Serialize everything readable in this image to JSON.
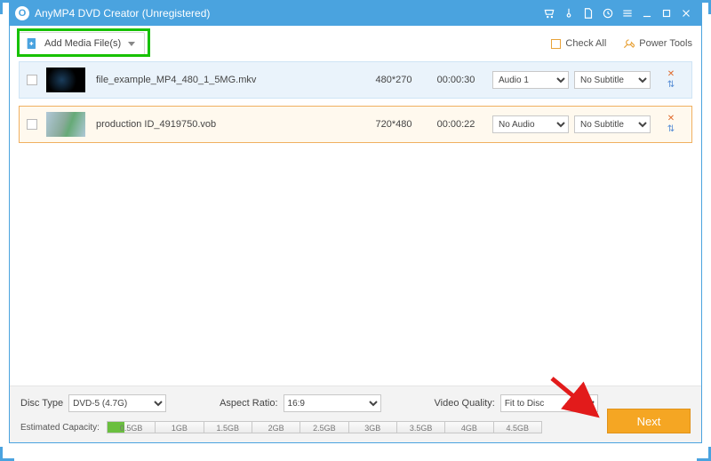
{
  "titlebar": {
    "title": "AnyMP4 DVD Creator (Unregistered)"
  },
  "toolbar": {
    "add_label": "Add Media File(s)",
    "check_all_label": "Check All",
    "power_tools_label": "Power Tools"
  },
  "files": [
    {
      "name": "file_example_MP4_480_1_5MG.mkv",
      "resolution": "480*270",
      "duration": "00:00:30",
      "audio": "Audio 1",
      "subtitle": "No Subtitle",
      "selected": false
    },
    {
      "name": "production ID_4919750.vob",
      "resolution": "720*480",
      "duration": "00:00:22",
      "audio": "No Audio",
      "subtitle": "No Subtitle",
      "selected": true
    }
  ],
  "bottom": {
    "disc_type_label": "Disc Type",
    "disc_type_value": "DVD-5 (4.7G)",
    "aspect_ratio_label": "Aspect Ratio:",
    "aspect_ratio_value": "16:9",
    "video_quality_label": "Video Quality:",
    "video_quality_value": "Fit to Disc",
    "estimated_capacity_label": "Estimated Capacity:",
    "ticks": [
      "0.5GB",
      "1GB",
      "1.5GB",
      "2GB",
      "2.5GB",
      "3GB",
      "3.5GB",
      "4GB",
      "4.5GB"
    ],
    "next_label": "Next"
  }
}
